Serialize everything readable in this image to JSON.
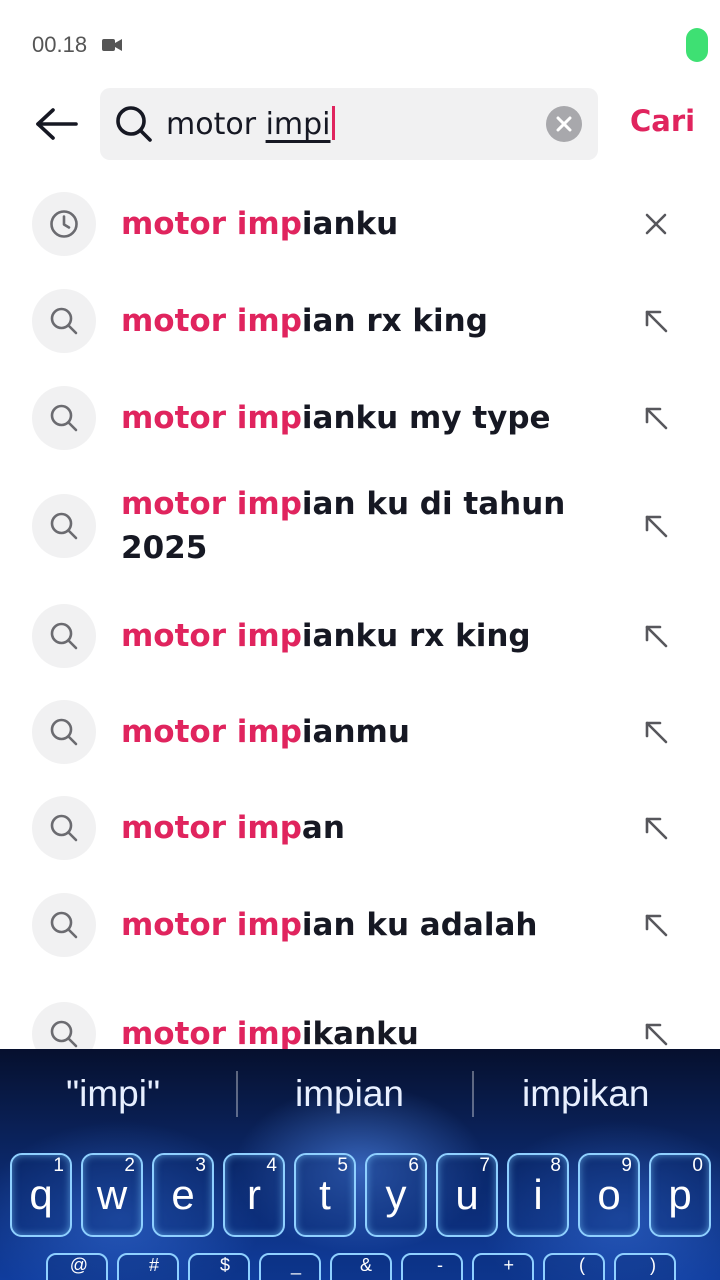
{
  "status": {
    "time": "00.18",
    "camera_icon": "video-camera-icon",
    "battery_color": "#3ee073"
  },
  "header": {
    "back_icon": "arrow-left-icon",
    "search": {
      "prefix": "motor ",
      "typed": "impi"
    },
    "clear_icon": "clear-x-icon",
    "submit_label": "Cari"
  },
  "accent_color": "#e0245e",
  "suggestions": [
    {
      "match": "motor imp",
      "rest": "ianku",
      "type": "history",
      "action": "remove"
    },
    {
      "match": "motor imp",
      "rest": "ian rx king",
      "type": "search",
      "action": "fill"
    },
    {
      "match": "motor imp",
      "rest": "ianku my type",
      "type": "search",
      "action": "fill"
    },
    {
      "match": "motor imp",
      "rest": "ian ku di tahun 2025",
      "type": "search",
      "action": "fill"
    },
    {
      "match": "motor imp",
      "rest": "ianku rx king",
      "type": "search",
      "action": "fill"
    },
    {
      "match": "motor imp",
      "rest": "ianmu",
      "type": "search",
      "action": "fill"
    },
    {
      "match": "motor imp",
      "rest": "an",
      "type": "search",
      "action": "fill"
    },
    {
      "match": "motor imp",
      "rest": "ian ku adalah",
      "type": "search",
      "action": "fill"
    },
    {
      "match": "motor imp",
      "rest": "ikanku",
      "type": "search",
      "action": "fill"
    }
  ],
  "keyboard": {
    "suggestions": [
      "\"impi\"",
      "impian",
      "impikan"
    ],
    "row1": [
      {
        "main": "q",
        "sub": "1"
      },
      {
        "main": "w",
        "sub": "2"
      },
      {
        "main": "e",
        "sub": "3"
      },
      {
        "main": "r",
        "sub": "4"
      },
      {
        "main": "t",
        "sub": "5"
      },
      {
        "main": "y",
        "sub": "6"
      },
      {
        "main": "u",
        "sub": "7"
      },
      {
        "main": "i",
        "sub": "8"
      },
      {
        "main": "o",
        "sub": "9"
      },
      {
        "main": "p",
        "sub": "0"
      }
    ],
    "row2_subs": [
      "@",
      "#",
      "$",
      "_",
      "&",
      "-",
      "+",
      "(",
      ")"
    ]
  }
}
